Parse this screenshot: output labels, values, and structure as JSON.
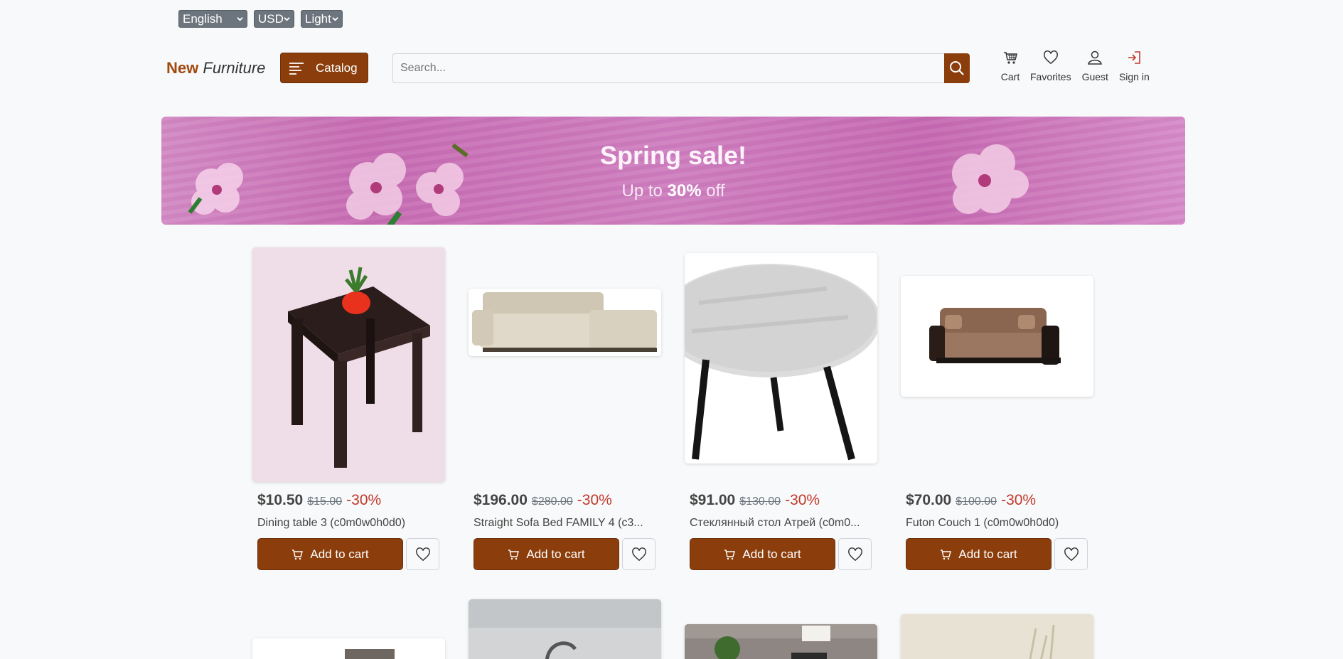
{
  "prefs": {
    "language": "English",
    "currency": "USD",
    "theme": "Light"
  },
  "brand": {
    "part1": "New",
    "part2": "Furniture"
  },
  "catalog_label": "Catalog",
  "search": {
    "placeholder": "Search..."
  },
  "nav": {
    "cart": "Cart",
    "favorites": "Favorites",
    "guest": "Guest",
    "signin": "Sign in"
  },
  "banner": {
    "title": "Spring sale!",
    "sub_prefix": "Up to",
    "sub_bold": "30%",
    "sub_suffix": "off"
  },
  "products": [
    {
      "price": "$10.50",
      "old_price": "$15.00",
      "discount": "-30%",
      "name": "Dining table 3 (c0m0w0h0d0)",
      "add_label": "Add to cart"
    },
    {
      "price": "$196.00",
      "old_price": "$280.00",
      "discount": "-30%",
      "name": "Straight Sofa Bed FAMILY 4 (c3...",
      "add_label": "Add to cart"
    },
    {
      "price": "$91.00",
      "old_price": "$130.00",
      "discount": "-30%",
      "name": "Стеклянный стол Атрей (c0m0...",
      "add_label": "Add to cart"
    },
    {
      "price": "$70.00",
      "old_price": "$100.00",
      "discount": "-30%",
      "name": "Futon Couch 1 (c0m0w0h0d0)",
      "add_label": "Add to cart"
    }
  ],
  "colors": {
    "accent": "#8b3e0c",
    "brand": "#a04a10",
    "discount": "#c0392b",
    "banner": "#cf7fc0"
  }
}
